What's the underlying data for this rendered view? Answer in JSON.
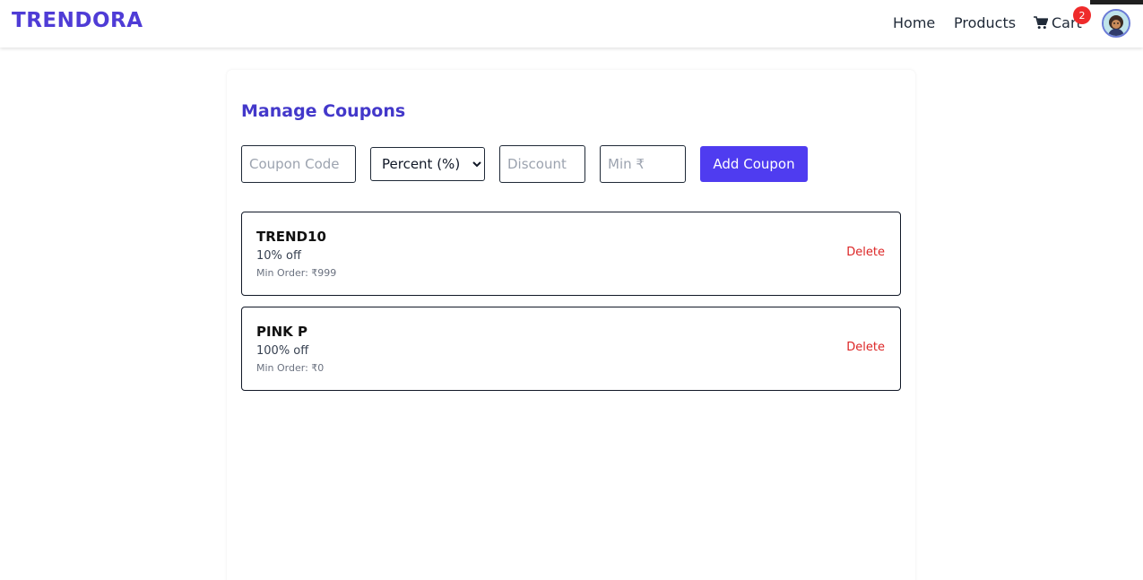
{
  "nav": {
    "brand": "TRENDORA",
    "home": "Home",
    "products": "Products",
    "cart": "Cart",
    "cart_count": "2",
    "cart_icon": "cart-icon",
    "avatar_icon": "avatar-icon"
  },
  "page": {
    "title": "Manage Coupons"
  },
  "form": {
    "code_placeholder": "Coupon Code",
    "type_selected": "Percent (%)",
    "discount_placeholder": "Discount",
    "min_placeholder": "Min ₹",
    "add_label": "Add Coupon"
  },
  "coupons": [
    {
      "code": "TREND10",
      "discount": "10% off",
      "min_order": "Min Order: ₹999",
      "delete_label": "Delete"
    },
    {
      "code": "PINK P",
      "discount": "100% off",
      "min_order": "Min Order: ₹0",
      "delete_label": "Delete"
    }
  ],
  "colors": {
    "brand": "#4f3cd6",
    "primary_button": "#4f3cf0",
    "title": "#4338ca",
    "danger": "#dc2626",
    "badge": "#ef2b2b"
  }
}
